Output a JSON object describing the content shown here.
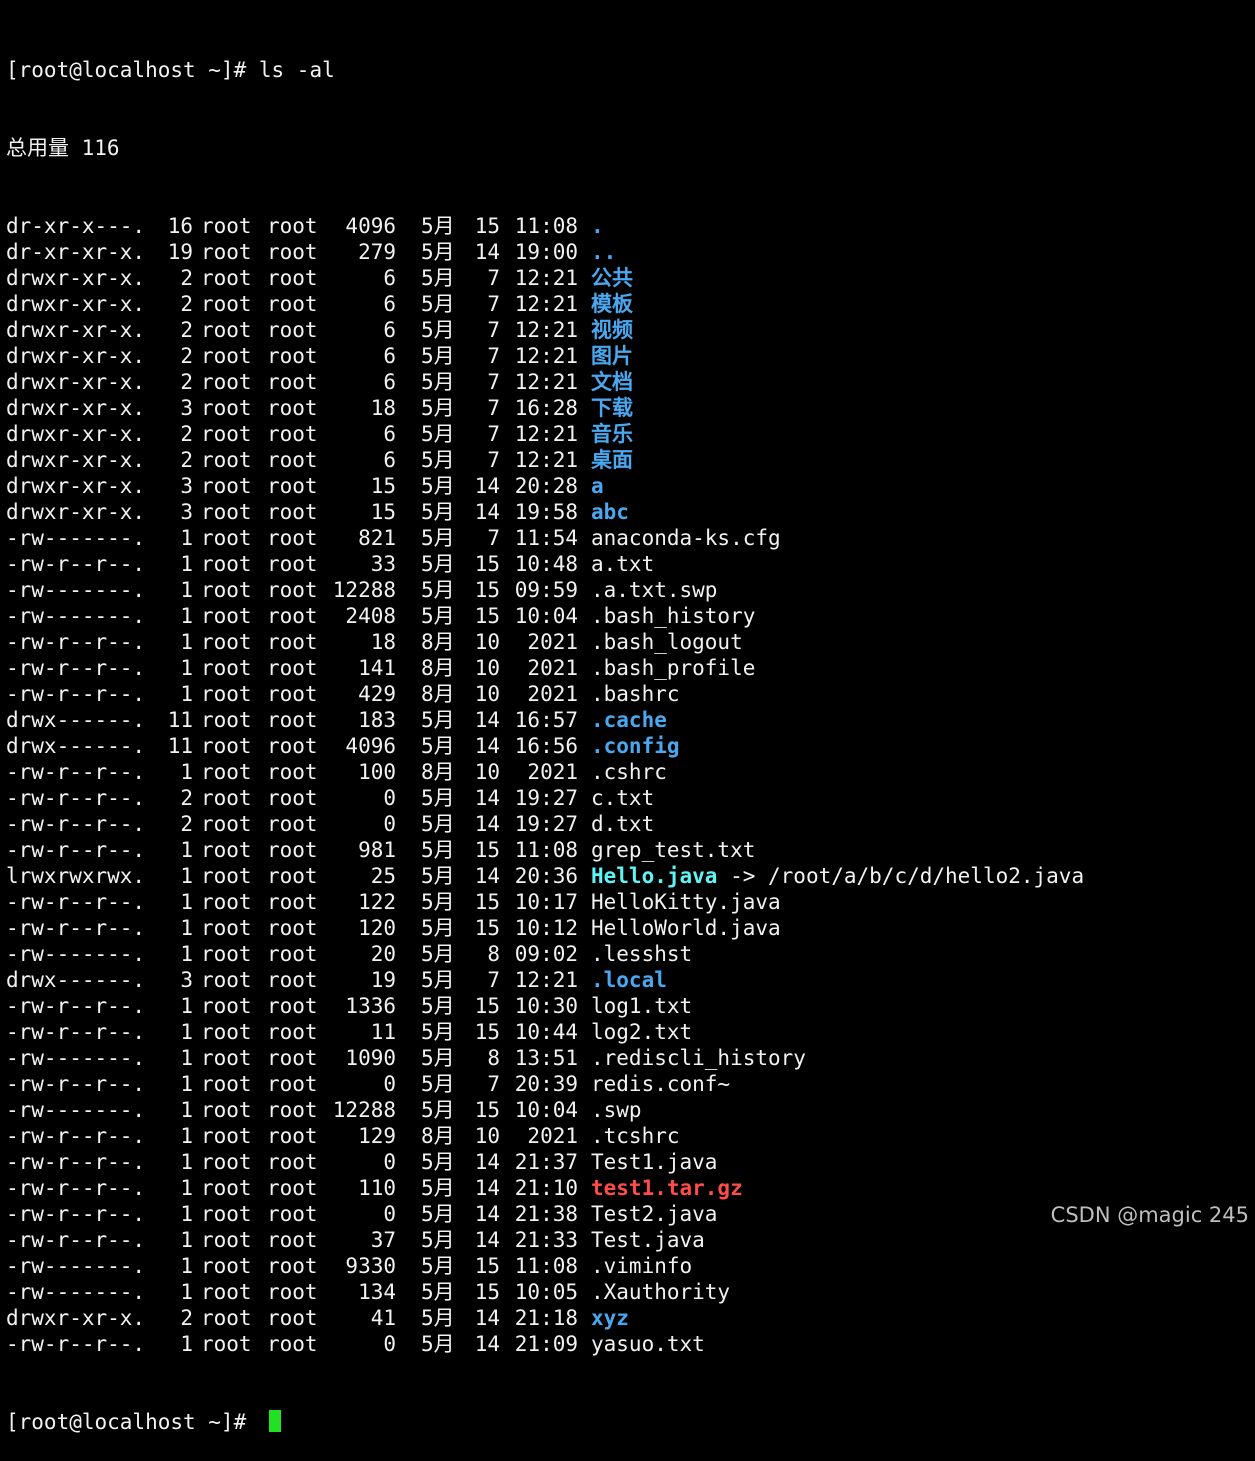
{
  "terminal": {
    "prompt": "[root@localhost ~]# ",
    "command": "ls -al",
    "total_line": "总用量 116",
    "final_prompt": "[root@localhost ~]# ",
    "entries": [
      {
        "perm": "dr-xr-x---.",
        "links": "16",
        "owner": "root",
        "group": "root",
        "size": "4096",
        "month": "5月",
        "day": "15",
        "time": "11:08",
        "name": ".",
        "kind": "dir"
      },
      {
        "perm": "dr-xr-xr-x.",
        "links": "19",
        "owner": "root",
        "group": "root",
        "size": "279",
        "month": "5月",
        "day": "14",
        "time": "19:00",
        "name": "..",
        "kind": "dir"
      },
      {
        "perm": "drwxr-xr-x.",
        "links": "2",
        "owner": "root",
        "group": "root",
        "size": "6",
        "month": "5月",
        "day": "7",
        "time": "12:21",
        "name": "公共",
        "kind": "dir"
      },
      {
        "perm": "drwxr-xr-x.",
        "links": "2",
        "owner": "root",
        "group": "root",
        "size": "6",
        "month": "5月",
        "day": "7",
        "time": "12:21",
        "name": "模板",
        "kind": "dir"
      },
      {
        "perm": "drwxr-xr-x.",
        "links": "2",
        "owner": "root",
        "group": "root",
        "size": "6",
        "month": "5月",
        "day": "7",
        "time": "12:21",
        "name": "视频",
        "kind": "dir"
      },
      {
        "perm": "drwxr-xr-x.",
        "links": "2",
        "owner": "root",
        "group": "root",
        "size": "6",
        "month": "5月",
        "day": "7",
        "time": "12:21",
        "name": "图片",
        "kind": "dir"
      },
      {
        "perm": "drwxr-xr-x.",
        "links": "2",
        "owner": "root",
        "group": "root",
        "size": "6",
        "month": "5月",
        "day": "7",
        "time": "12:21",
        "name": "文档",
        "kind": "dir"
      },
      {
        "perm": "drwxr-xr-x.",
        "links": "3",
        "owner": "root",
        "group": "root",
        "size": "18",
        "month": "5月",
        "day": "7",
        "time": "16:28",
        "name": "下载",
        "kind": "dir"
      },
      {
        "perm": "drwxr-xr-x.",
        "links": "2",
        "owner": "root",
        "group": "root",
        "size": "6",
        "month": "5月",
        "day": "7",
        "time": "12:21",
        "name": "音乐",
        "kind": "dir"
      },
      {
        "perm": "drwxr-xr-x.",
        "links": "2",
        "owner": "root",
        "group": "root",
        "size": "6",
        "month": "5月",
        "day": "7",
        "time": "12:21",
        "name": "桌面",
        "kind": "dir"
      },
      {
        "perm": "drwxr-xr-x.",
        "links": "3",
        "owner": "root",
        "group": "root",
        "size": "15",
        "month": "5月",
        "day": "14",
        "time": "20:28",
        "name": "a",
        "kind": "dir"
      },
      {
        "perm": "drwxr-xr-x.",
        "links": "3",
        "owner": "root",
        "group": "root",
        "size": "15",
        "month": "5月",
        "day": "14",
        "time": "19:58",
        "name": "abc",
        "kind": "dir"
      },
      {
        "perm": "-rw-------.",
        "links": "1",
        "owner": "root",
        "group": "root",
        "size": "821",
        "month": "5月",
        "day": "7",
        "time": "11:54",
        "name": "anaconda-ks.cfg",
        "kind": "plain"
      },
      {
        "perm": "-rw-r--r--.",
        "links": "1",
        "owner": "root",
        "group": "root",
        "size": "33",
        "month": "5月",
        "day": "15",
        "time": "10:48",
        "name": "a.txt",
        "kind": "plain"
      },
      {
        "perm": "-rw-------.",
        "links": "1",
        "owner": "root",
        "group": "root",
        "size": "12288",
        "month": "5月",
        "day": "15",
        "time": "09:59",
        "name": ".a.txt.swp",
        "kind": "plain"
      },
      {
        "perm": "-rw-------.",
        "links": "1",
        "owner": "root",
        "group": "root",
        "size": "2408",
        "month": "5月",
        "day": "15",
        "time": "10:04",
        "name": ".bash_history",
        "kind": "plain"
      },
      {
        "perm": "-rw-r--r--.",
        "links": "1",
        "owner": "root",
        "group": "root",
        "size": "18",
        "month": "8月",
        "day": "10",
        "time": "2021",
        "name": ".bash_logout",
        "kind": "plain"
      },
      {
        "perm": "-rw-r--r--.",
        "links": "1",
        "owner": "root",
        "group": "root",
        "size": "141",
        "month": "8月",
        "day": "10",
        "time": "2021",
        "name": ".bash_profile",
        "kind": "plain"
      },
      {
        "perm": "-rw-r--r--.",
        "links": "1",
        "owner": "root",
        "group": "root",
        "size": "429",
        "month": "8月",
        "day": "10",
        "time": "2021",
        "name": ".bashrc",
        "kind": "plain"
      },
      {
        "perm": "drwx------.",
        "links": "11",
        "owner": "root",
        "group": "root",
        "size": "183",
        "month": "5月",
        "day": "14",
        "time": "16:57",
        "name": ".cache",
        "kind": "dir"
      },
      {
        "perm": "drwx------.",
        "links": "11",
        "owner": "root",
        "group": "root",
        "size": "4096",
        "month": "5月",
        "day": "14",
        "time": "16:56",
        "name": ".config",
        "kind": "dir"
      },
      {
        "perm": "-rw-r--r--.",
        "links": "1",
        "owner": "root",
        "group": "root",
        "size": "100",
        "month": "8月",
        "day": "10",
        "time": "2021",
        "name": ".cshrc",
        "kind": "plain"
      },
      {
        "perm": "-rw-r--r--.",
        "links": "2",
        "owner": "root",
        "group": "root",
        "size": "0",
        "month": "5月",
        "day": "14",
        "time": "19:27",
        "name": "c.txt",
        "kind": "plain"
      },
      {
        "perm": "-rw-r--r--.",
        "links": "2",
        "owner": "root",
        "group": "root",
        "size": "0",
        "month": "5月",
        "day": "14",
        "time": "19:27",
        "name": "d.txt",
        "kind": "plain"
      },
      {
        "perm": "-rw-r--r--.",
        "links": "1",
        "owner": "root",
        "group": "root",
        "size": "981",
        "month": "5月",
        "day": "15",
        "time": "11:08",
        "name": "grep_test.txt",
        "kind": "plain"
      },
      {
        "perm": "lrwxrwxrwx.",
        "links": "1",
        "owner": "root",
        "group": "root",
        "size": "25",
        "month": "5月",
        "day": "14",
        "time": "20:36",
        "name": "Hello.java",
        "kind": "link",
        "target": " -> /root/a/b/c/d/hello2.java"
      },
      {
        "perm": "-rw-r--r--.",
        "links": "1",
        "owner": "root",
        "group": "root",
        "size": "122",
        "month": "5月",
        "day": "15",
        "time": "10:17",
        "name": "HelloKitty.java",
        "kind": "plain"
      },
      {
        "perm": "-rw-r--r--.",
        "links": "1",
        "owner": "root",
        "group": "root",
        "size": "120",
        "month": "5月",
        "day": "15",
        "time": "10:12",
        "name": "HelloWorld.java",
        "kind": "plain"
      },
      {
        "perm": "-rw-------.",
        "links": "1",
        "owner": "root",
        "group": "root",
        "size": "20",
        "month": "5月",
        "day": "8",
        "time": "09:02",
        "name": ".lesshst",
        "kind": "plain"
      },
      {
        "perm": "drwx------.",
        "links": "3",
        "owner": "root",
        "group": "root",
        "size": "19",
        "month": "5月",
        "day": "7",
        "time": "12:21",
        "name": ".local",
        "kind": "dir"
      },
      {
        "perm": "-rw-r--r--.",
        "links": "1",
        "owner": "root",
        "group": "root",
        "size": "1336",
        "month": "5月",
        "day": "15",
        "time": "10:30",
        "name": "log1.txt",
        "kind": "plain"
      },
      {
        "perm": "-rw-r--r--.",
        "links": "1",
        "owner": "root",
        "group": "root",
        "size": "11",
        "month": "5月",
        "day": "15",
        "time": "10:44",
        "name": "log2.txt",
        "kind": "plain"
      },
      {
        "perm": "-rw-------.",
        "links": "1",
        "owner": "root",
        "group": "root",
        "size": "1090",
        "month": "5月",
        "day": "8",
        "time": "13:51",
        "name": ".rediscli_history",
        "kind": "plain"
      },
      {
        "perm": "-rw-r--r--.",
        "links": "1",
        "owner": "root",
        "group": "root",
        "size": "0",
        "month": "5月",
        "day": "7",
        "time": "20:39",
        "name": "redis.conf~",
        "kind": "plain"
      },
      {
        "perm": "-rw-------.",
        "links": "1",
        "owner": "root",
        "group": "root",
        "size": "12288",
        "month": "5月",
        "day": "15",
        "time": "10:04",
        "name": ".swp",
        "kind": "plain"
      },
      {
        "perm": "-rw-r--r--.",
        "links": "1",
        "owner": "root",
        "group": "root",
        "size": "129",
        "month": "8月",
        "day": "10",
        "time": "2021",
        "name": ".tcshrc",
        "kind": "plain"
      },
      {
        "perm": "-rw-r--r--.",
        "links": "1",
        "owner": "root",
        "group": "root",
        "size": "0",
        "month": "5月",
        "day": "14",
        "time": "21:37",
        "name": "Test1.java",
        "kind": "plain"
      },
      {
        "perm": "-rw-r--r--.",
        "links": "1",
        "owner": "root",
        "group": "root",
        "size": "110",
        "month": "5月",
        "day": "14",
        "time": "21:10",
        "name": "test1.tar.gz",
        "kind": "archive"
      },
      {
        "perm": "-rw-r--r--.",
        "links": "1",
        "owner": "root",
        "group": "root",
        "size": "0",
        "month": "5月",
        "day": "14",
        "time": "21:38",
        "name": "Test2.java",
        "kind": "plain"
      },
      {
        "perm": "-rw-r--r--.",
        "links": "1",
        "owner": "root",
        "group": "root",
        "size": "37",
        "month": "5月",
        "day": "14",
        "time": "21:33",
        "name": "Test.java",
        "kind": "plain"
      },
      {
        "perm": "-rw-------.",
        "links": "1",
        "owner": "root",
        "group": "root",
        "size": "9330",
        "month": "5月",
        "day": "15",
        "time": "11:08",
        "name": ".viminfo",
        "kind": "plain"
      },
      {
        "perm": "-rw-------.",
        "links": "1",
        "owner": "root",
        "group": "root",
        "size": "134",
        "month": "5月",
        "day": "15",
        "time": "10:05",
        "name": ".Xauthority",
        "kind": "plain"
      },
      {
        "perm": "drwxr-xr-x.",
        "links": "2",
        "owner": "root",
        "group": "root",
        "size": "41",
        "month": "5月",
        "day": "14",
        "time": "21:18",
        "name": "xyz",
        "kind": "dir"
      },
      {
        "perm": "-rw-r--r--.",
        "links": "1",
        "owner": "root",
        "group": "root",
        "size": "0",
        "month": "5月",
        "day": "14",
        "time": "21:09",
        "name": "yasuo.txt",
        "kind": "plain"
      }
    ]
  },
  "watermark": "CSDN @magic 245",
  "colors": {
    "background": "#000000",
    "text": "#f2f2f2",
    "directory": "#4aa8f0",
    "symlink": "#5ff5f5",
    "archive": "#ff4b4b",
    "cursor": "#22e022"
  }
}
